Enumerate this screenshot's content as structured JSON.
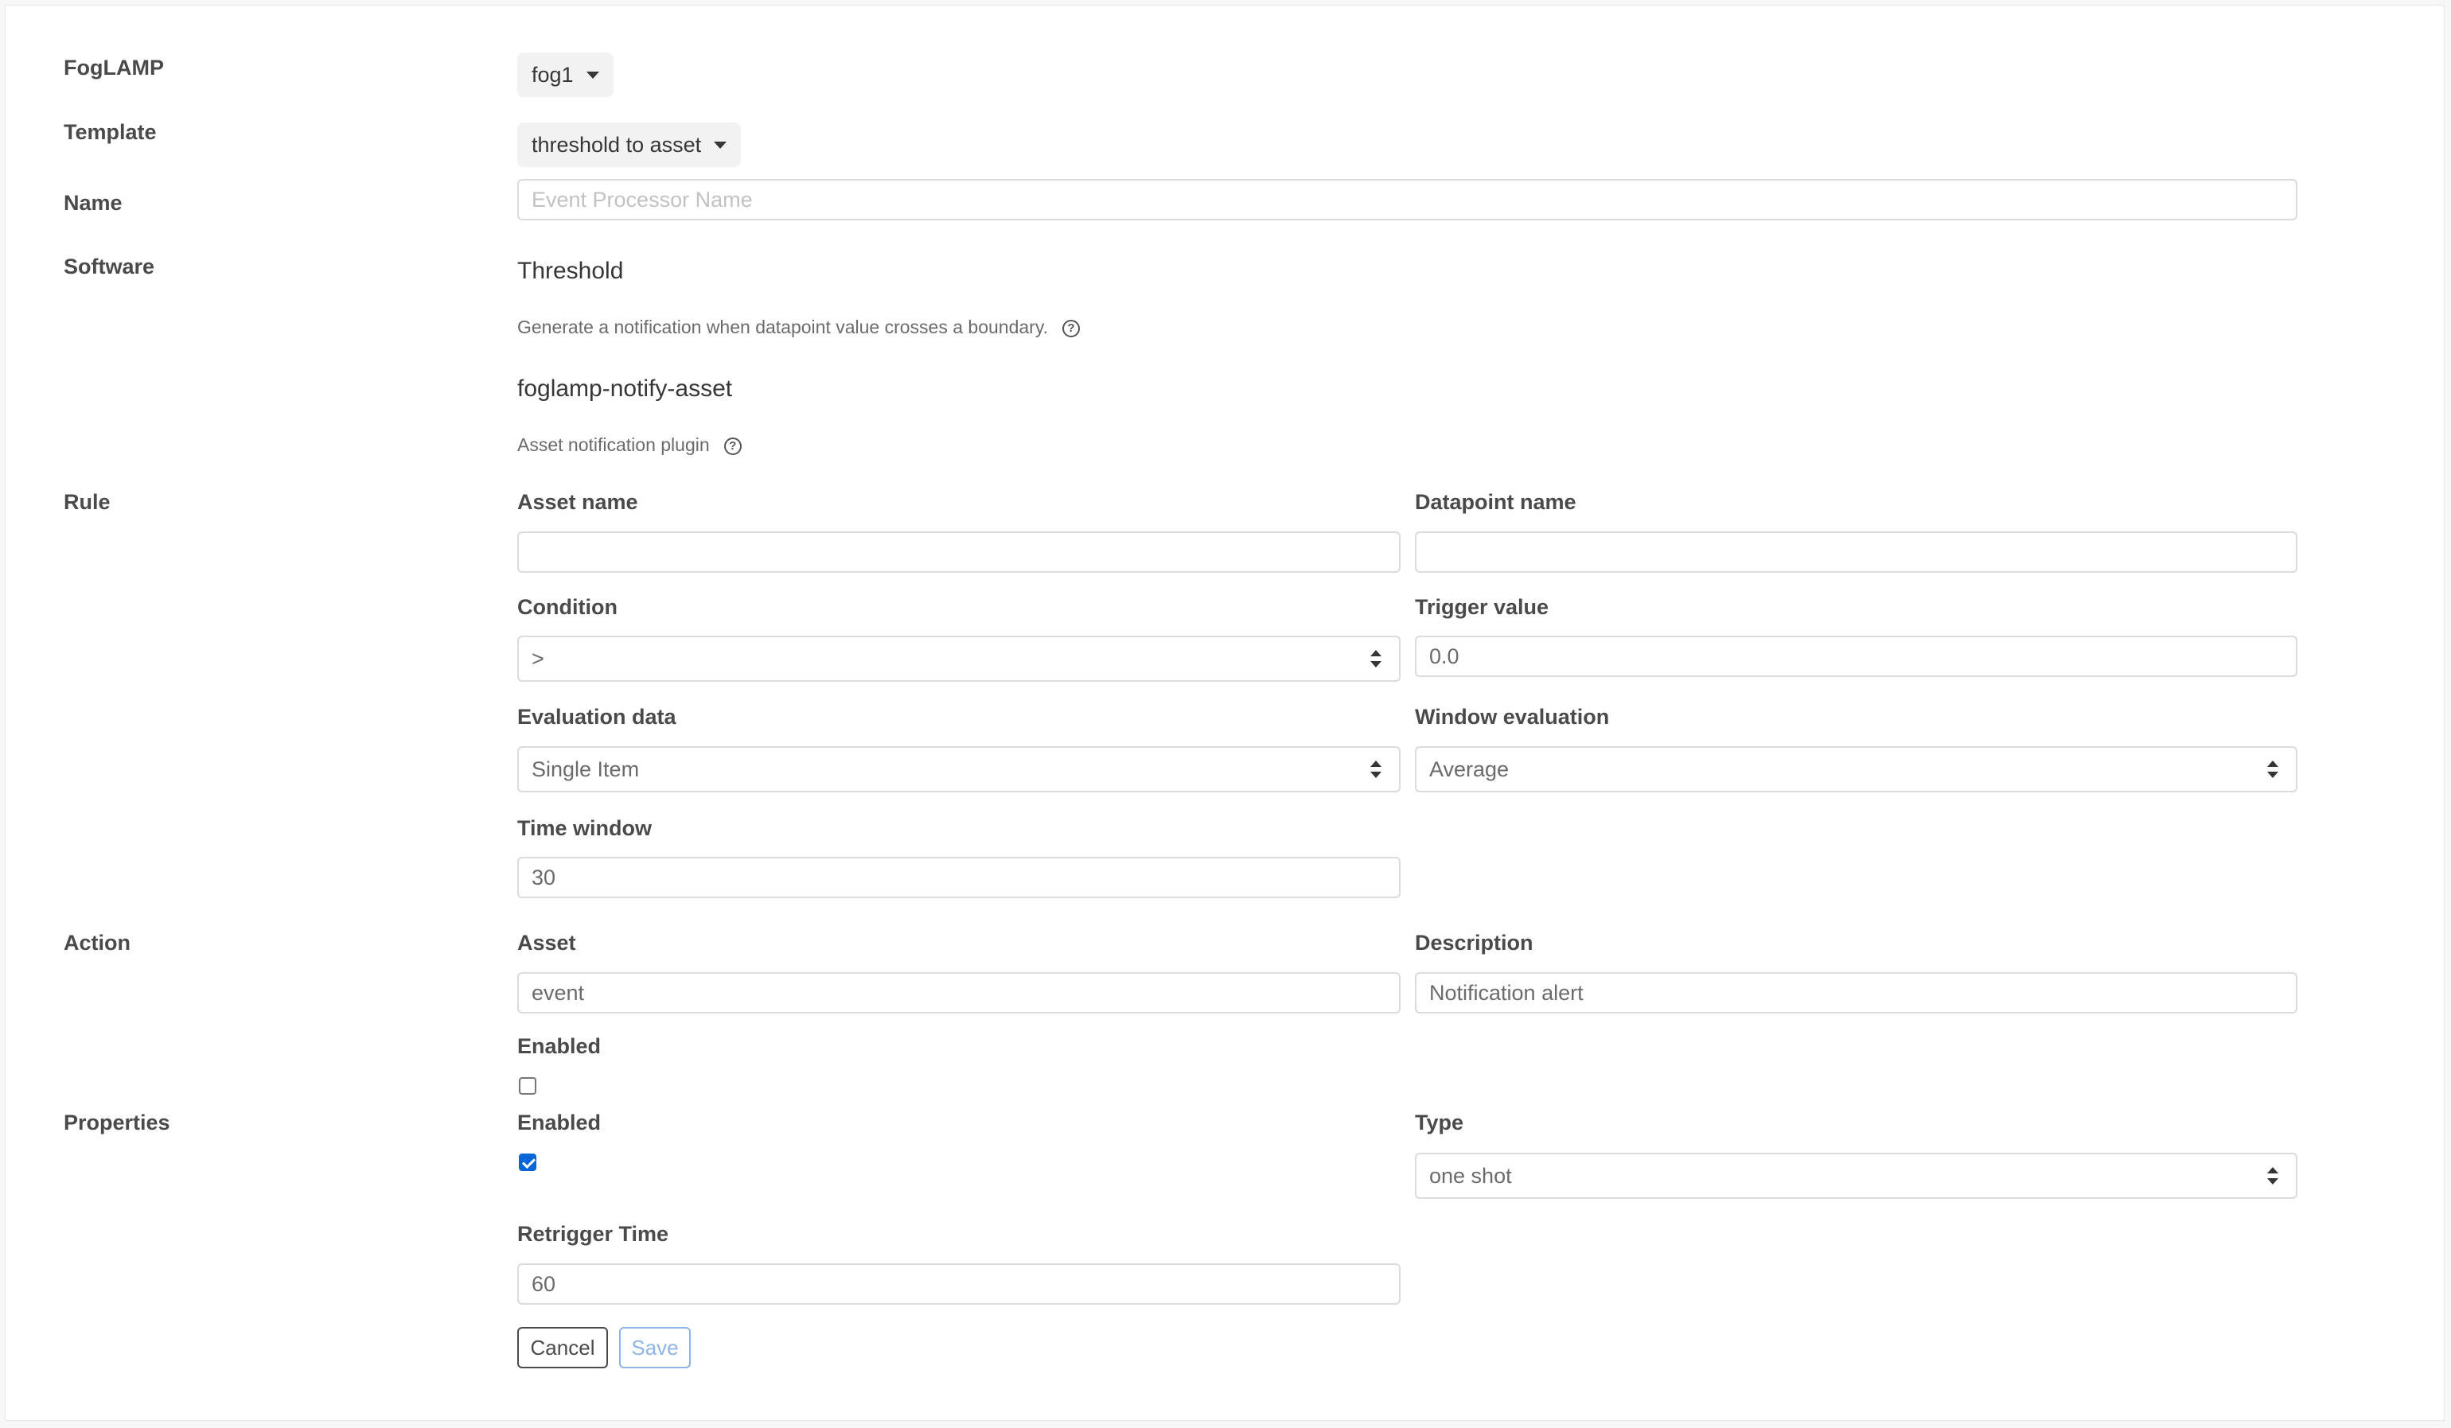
{
  "sections": {
    "foglamp": "FogLAMP",
    "template": "Template",
    "name": "Name",
    "software": "Software",
    "rule": "Rule",
    "action": "Action",
    "properties": "Properties"
  },
  "foglamp_dropdown": {
    "value": "fog1"
  },
  "template_dropdown": {
    "value": "threshold to asset"
  },
  "name_input": {
    "placeholder": "Event Processor Name",
    "value": ""
  },
  "software": {
    "rule_plugin": {
      "title": "Threshold",
      "description": "Generate a notification when datapoint value crosses a boundary."
    },
    "delivery_plugin": {
      "title": "foglamp-notify-asset",
      "description": "Asset notification plugin"
    },
    "help_icon": "question-circle-icon"
  },
  "rule": {
    "asset_name": {
      "label": "Asset name",
      "value": ""
    },
    "datapoint_name": {
      "label": "Datapoint name",
      "value": ""
    },
    "condition": {
      "label": "Condition",
      "value": ">"
    },
    "trigger_value": {
      "label": "Trigger value",
      "value": "0.0"
    },
    "evaluation_data": {
      "label": "Evaluation data",
      "value": "Single Item"
    },
    "window_evaluation": {
      "label": "Window evaluation",
      "value": "Average"
    },
    "time_window": {
      "label": "Time window",
      "value": "30"
    }
  },
  "action": {
    "asset": {
      "label": "Asset",
      "value": "event"
    },
    "description": {
      "label": "Description",
      "value": "Notification alert"
    },
    "enabled": {
      "label": "Enabled",
      "checked": false
    }
  },
  "properties": {
    "enabled": {
      "label": "Enabled",
      "checked": true
    },
    "type": {
      "label": "Type",
      "value": "one shot"
    },
    "retrigger_time": {
      "label": "Retrigger Time",
      "value": "60"
    }
  },
  "buttons": {
    "cancel": "Cancel",
    "save": "Save"
  },
  "colors": {
    "accent": "#0a66d8",
    "save_border": "#8fb4e8",
    "text": "#4a4a4a"
  }
}
